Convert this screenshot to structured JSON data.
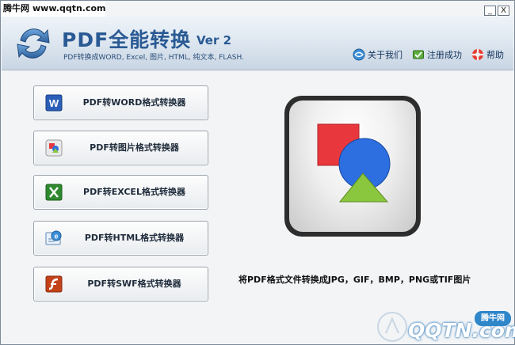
{
  "watermark_top": {
    "site": "腾牛网",
    "url": "www.qqtn.com"
  },
  "window_controls": {
    "minimize": "_",
    "close": "X"
  },
  "header": {
    "title": "PDF全能转换",
    "version": "Ver 2",
    "subtitle": "PDF转换成WORD, Excel, 图片, HTML, 纯文本, FLASH.",
    "links": [
      {
        "label": "关于我们",
        "icon": "globe-icon"
      },
      {
        "label": "注册成功",
        "icon": "register-icon"
      },
      {
        "label": "帮助",
        "icon": "lifebuoy-icon"
      }
    ]
  },
  "buttons": [
    {
      "label": "PDF转WORD格式转换器",
      "icon": "word-icon"
    },
    {
      "label": "PDF转图片格式转换器",
      "icon": "image-icon"
    },
    {
      "label": "PDF转EXCEL格式转换器",
      "icon": "excel-icon"
    },
    {
      "label": "PDF转HTML格式转换器",
      "icon": "html-icon"
    },
    {
      "label": "PDF转SWF格式转换器",
      "icon": "swf-icon"
    }
  ],
  "description": "将PDF格式文件转换成JPG，GIF，BMP，PNG或TIF图片",
  "watermark_bottom": {
    "brand": "QQTN.com",
    "badge": "腾牛网"
  },
  "colors": {
    "title": "#2a5a94",
    "word": "#2b5eb8",
    "excel": "#2f8a2f",
    "swf": "#c4421a",
    "shape_red": "#e8383d",
    "shape_blue": "#2d6fe0",
    "shape_green": "#8bc63f"
  }
}
